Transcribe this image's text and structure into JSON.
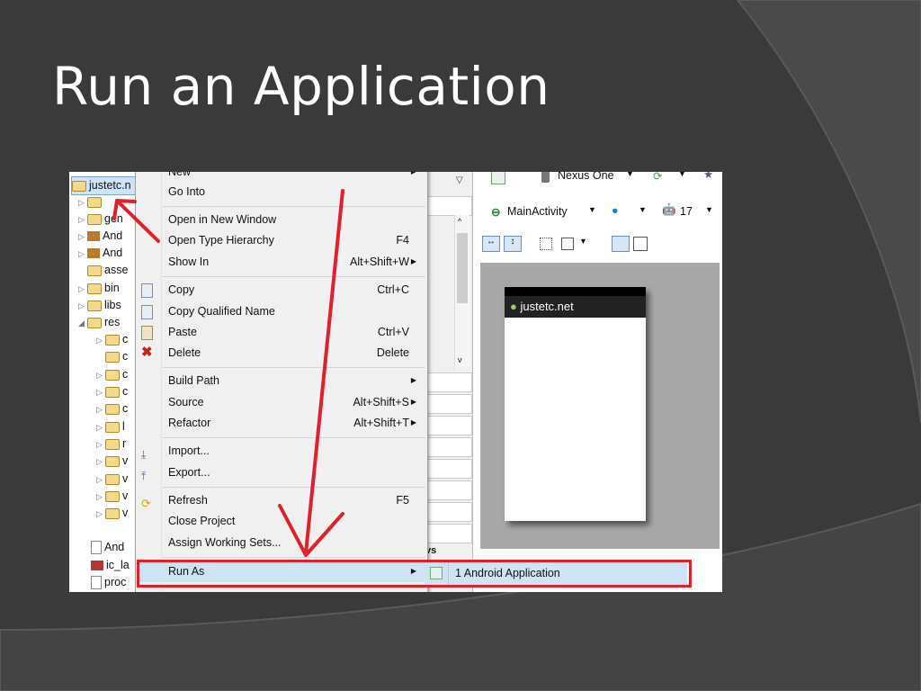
{
  "slide": {
    "title": "Run an Application"
  },
  "tree": {
    "project": "justetc.n",
    "items": [
      "gen",
      "And",
      "And",
      "asse",
      "bin",
      "libs",
      "res",
      "And",
      "ic_la",
      "proc"
    ],
    "res_children": [
      "c",
      "c",
      "c",
      "c",
      "c",
      "l",
      "r",
      "v",
      "v",
      "v",
      "v"
    ]
  },
  "menu": {
    "items": [
      {
        "label": "New",
        "shortcut": ""
      },
      {
        "label": "Go Into",
        "shortcut": ""
      },
      {
        "label": "Open in New Window",
        "shortcut": ""
      },
      {
        "label": "Open Type Hierarchy",
        "shortcut": "F4"
      },
      {
        "label": "Show In",
        "shortcut": "Alt+Shift+W"
      },
      {
        "label": "Copy",
        "shortcut": "Ctrl+C"
      },
      {
        "label": "Copy Qualified Name",
        "shortcut": ""
      },
      {
        "label": "Paste",
        "shortcut": "Ctrl+V"
      },
      {
        "label": "Delete",
        "shortcut": "Delete"
      },
      {
        "label": "Build Path",
        "shortcut": ""
      },
      {
        "label": "Source",
        "shortcut": "Alt+Shift+S"
      },
      {
        "label": "Refactor",
        "shortcut": "Alt+Shift+T"
      },
      {
        "label": "Import...",
        "shortcut": ""
      },
      {
        "label": "Export...",
        "shortcut": ""
      },
      {
        "label": "Refresh",
        "shortcut": "F5"
      },
      {
        "label": "Close Project",
        "shortcut": ""
      },
      {
        "label": "Assign Working Sets...",
        "shortcut": ""
      },
      {
        "label": "Run As",
        "shortcut": ""
      }
    ],
    "submenu_item": "1 Android Application"
  },
  "toolbar": {
    "device": "Nexus One",
    "activity": "MainActivity",
    "api_level": "17"
  },
  "preview": {
    "app_title": "justetc.net"
  },
  "middle": {
    "partial_text": "vs"
  },
  "colors": {
    "highlight": "#e0202a",
    "slide_bg": "#3a3a3a"
  }
}
